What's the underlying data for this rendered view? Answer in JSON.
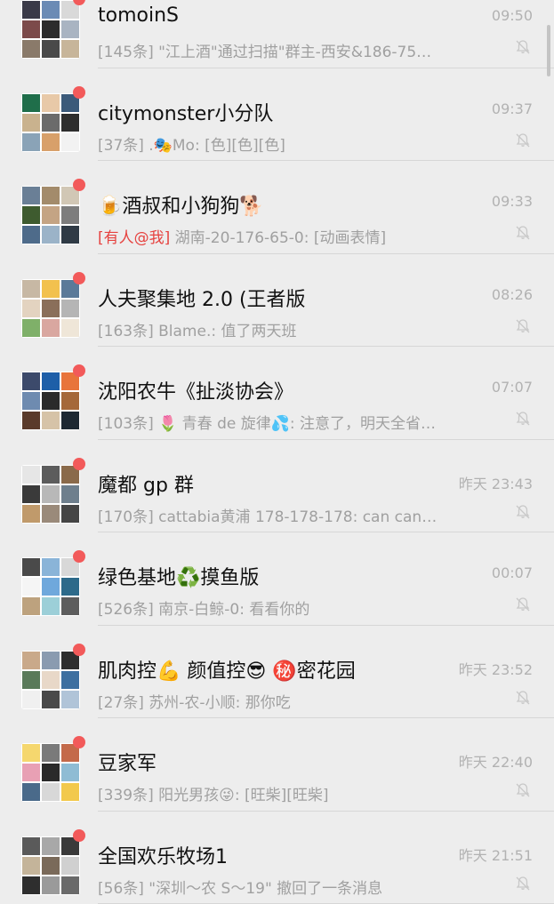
{
  "chats": [
    {
      "title": "tomoinS",
      "prefix": "",
      "subtitle": "[145条] \"江上酒\"通过扫描\"群主-西安&186-75…",
      "time": "09:50",
      "avatar_colors": [
        "#3a3a48",
        "#6b8bb5",
        "#d9d9d9",
        "#7c4a4a",
        "#2c2c2c",
        "#a9b4c2",
        "#8a7a6a",
        "#4a4a4a",
        "#c7b59a"
      ]
    },
    {
      "title": "citymonster小分队",
      "prefix": "",
      "subtitle": "[37条] .🎭Mo: [色][色][色]",
      "time": "09:37",
      "avatar_colors": [
        "#1f6e4a",
        "#e8c9a8",
        "#3b5a7a",
        "#c9b28e",
        "#6b6b6b",
        "#2e2e2e",
        "#8aa3b7",
        "#d8a06a",
        "#f2f2f2"
      ]
    },
    {
      "title": "🍺酒叔和小狗狗🐕",
      "prefix": "[有人@我] ",
      "subtitle": "湖南-20-176-65-0: [动画表情]",
      "time": "09:33",
      "avatar_colors": [
        "#6a7f96",
        "#a38b6b",
        "#d1c7b5",
        "#3e5b2f",
        "#c4a484",
        "#7d7d7d",
        "#4e6b8a",
        "#9bb3c8",
        "#2f3a45"
      ]
    },
    {
      "title": "人夫聚集地 2.0 (王者版",
      "prefix": "",
      "subtitle": "[163条] Blame.: 值了两天班",
      "time": "08:26",
      "avatar_colors": [
        "#c7b8a4",
        "#f2c14e",
        "#5b7a99",
        "#e3d3c0",
        "#8a6f5a",
        "#b5b5b5",
        "#7fb069",
        "#d9a7a0",
        "#efe6d8"
      ]
    },
    {
      "title": "沈阳农牛《扯淡协会》",
      "prefix": "",
      "subtitle": "[103条] 🌷 青春 de 旋律💦: 注意了，明天全省…",
      "time": "07:07",
      "avatar_colors": [
        "#3c4a6b",
        "#1e5fa8",
        "#e8743b",
        "#6e8bb0",
        "#2b2b2b",
        "#a5683a",
        "#5a3a2a",
        "#d6c3a8",
        "#1c2833"
      ]
    },
    {
      "title": "魔都 gp 群",
      "prefix": "",
      "subtitle": "[170条] cattabia黄浦 178-178-178: can can…",
      "time": "昨天 23:43",
      "avatar_colors": [
        "#e6e6e6",
        "#5c5c5c",
        "#8a6a4a",
        "#3a3a3a",
        "#b8b8b8",
        "#6e7f8d",
        "#c09a6b",
        "#9a8a7a",
        "#454545"
      ]
    },
    {
      "title": "绿色基地♻️摸鱼版",
      "prefix": "",
      "subtitle": "[526条] 南京-白鲸-0: 看看你的",
      "time": "00:07",
      "avatar_colors": [
        "#4a4a4a",
        "#8ab4d8",
        "#d8d8d8",
        "#f5f5f5",
        "#6fa8dc",
        "#2d6a8a",
        "#bda27e",
        "#9ccfd8",
        "#5d5d5d"
      ]
    },
    {
      "title": "肌肉控💪 颜值控😎 ㊙️密花园",
      "prefix": "",
      "subtitle": "[27条] 苏州-农-小顺: 那你吃",
      "time": "昨天 23:52",
      "avatar_colors": [
        "#c9a98a",
        "#8a9bb0",
        "#2e2e2e",
        "#5a7a5a",
        "#e8d8c8",
        "#3d6fa0",
        "#f0f0f0",
        "#4a4a4a",
        "#b0c4d8"
      ]
    },
    {
      "title": "豆家军",
      "prefix": "",
      "subtitle": "[339条] 阳光男孩😜: [旺柴][旺柴]",
      "time": "昨天 22:40",
      "avatar_colors": [
        "#f5d76e",
        "#7a7a7a",
        "#c46a4a",
        "#e8a0b4",
        "#2a2a2a",
        "#8fbcd4",
        "#4a6a8a",
        "#d8d8d8",
        "#f2c94c"
      ]
    },
    {
      "title": "全国欢乐牧场1",
      "prefix": "",
      "subtitle": "[56条] \"深圳～农 S～19\" 撤回了一条消息",
      "time": "昨天 21:51",
      "avatar_colors": [
        "#5a5a5a",
        "#a8a8a8",
        "#3a3a3a",
        "#c4b49a",
        "#7a6a5a",
        "#d0d0d0",
        "#2e2e2e",
        "#9a9a9a",
        "#6a6a6a"
      ]
    }
  ]
}
